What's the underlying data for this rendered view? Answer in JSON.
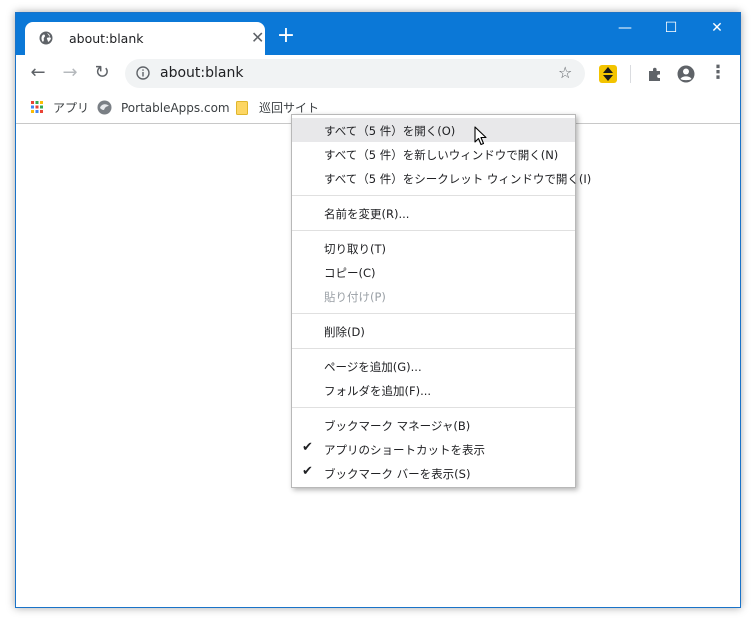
{
  "tab": {
    "title": "about:blank",
    "close": "✕"
  },
  "new_tab": "+",
  "window_controls": {
    "minimize": "—",
    "maximize": "☐",
    "close": "✕"
  },
  "toolbar": {
    "back": "←",
    "forward": "→",
    "reload": "↻",
    "more": "⋮"
  },
  "omnibox": {
    "url": "about:blank",
    "star": "☆"
  },
  "bookmarks_bar": {
    "apps": "アプリ",
    "portableapps": "PortableApps.com",
    "folder": "巡回サイト"
  },
  "context_menu": {
    "open_all": "すべて（5 件）を開く(O)",
    "open_all_new_window": "すべて（5 件）を新しいウィンドウで開く(N)",
    "open_all_incognito": "すべて（5 件）をシークレット ウィンドウで開く(I)",
    "rename": "名前を変更(R)...",
    "cut": "切り取り(T)",
    "copy": "コピー(C)",
    "paste": "貼り付け(P)",
    "delete": "削除(D)",
    "add_page": "ページを追加(G)...",
    "add_folder": "フォルダを追加(F)...",
    "bookmark_manager": "ブックマーク マネージャ(B)",
    "show_apps_shortcut": "アプリのショートカットを表示",
    "show_bookmarks_bar": "ブックマーク バーを表示(S)",
    "check": "✔"
  },
  "colors": {
    "titlebar": "#0b78d7",
    "extension": "#f3c400"
  }
}
